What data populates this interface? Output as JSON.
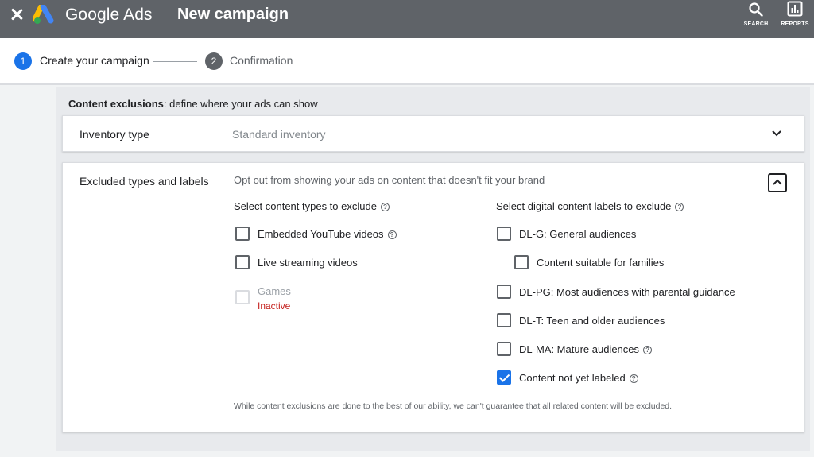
{
  "app": {
    "brand": "Google Ads",
    "page_title": "New campaign"
  },
  "toolbar": {
    "search_label": "SEARCH",
    "reports_label": "REPORTS"
  },
  "stepper": {
    "steps": [
      {
        "number": "1",
        "label": "Create your campaign",
        "state": "active"
      },
      {
        "number": "2",
        "label": "Confirmation",
        "state": "inactive"
      }
    ]
  },
  "section": {
    "title_bold": "Content exclusions",
    "title_rest": ": define where your ads can show"
  },
  "inventory": {
    "label": "Inventory type",
    "value": "Standard inventory",
    "icon": "chevron-down-icon"
  },
  "exclusions": {
    "label": "Excluded types and labels",
    "description": "Opt out from showing your ads on content that doesn't fit your brand",
    "content_types_heading": "Select content types to exclude",
    "content_types": [
      {
        "label": "Embedded YouTube videos",
        "checked": false,
        "help": true
      },
      {
        "label": "Live streaming videos",
        "checked": false,
        "help": false
      },
      {
        "label": "Games",
        "checked": false,
        "disabled": true,
        "status": "Inactive"
      }
    ],
    "labels_heading": "Select digital content labels to exclude",
    "labels": [
      {
        "label": "DL-G: General audiences",
        "checked": false
      },
      {
        "label": "Content suitable for families",
        "checked": false,
        "indented": true
      },
      {
        "label": "DL-PG: Most audiences with parental guidance",
        "checked": false
      },
      {
        "label": "DL-T: Teen and older audiences",
        "checked": false
      },
      {
        "label": "DL-MA: Mature audiences",
        "checked": false,
        "help": true
      },
      {
        "label": "Content not yet labeled",
        "checked": true,
        "help": true
      }
    ],
    "disclaimer": "While content exclusions are done to the best of our ability, we can't guarantee that all related content will be excluded."
  },
  "colors": {
    "topbar": "#5f6368",
    "accent": "#1a73e8",
    "error": "#c5221f",
    "panel": "#e8eaed"
  }
}
